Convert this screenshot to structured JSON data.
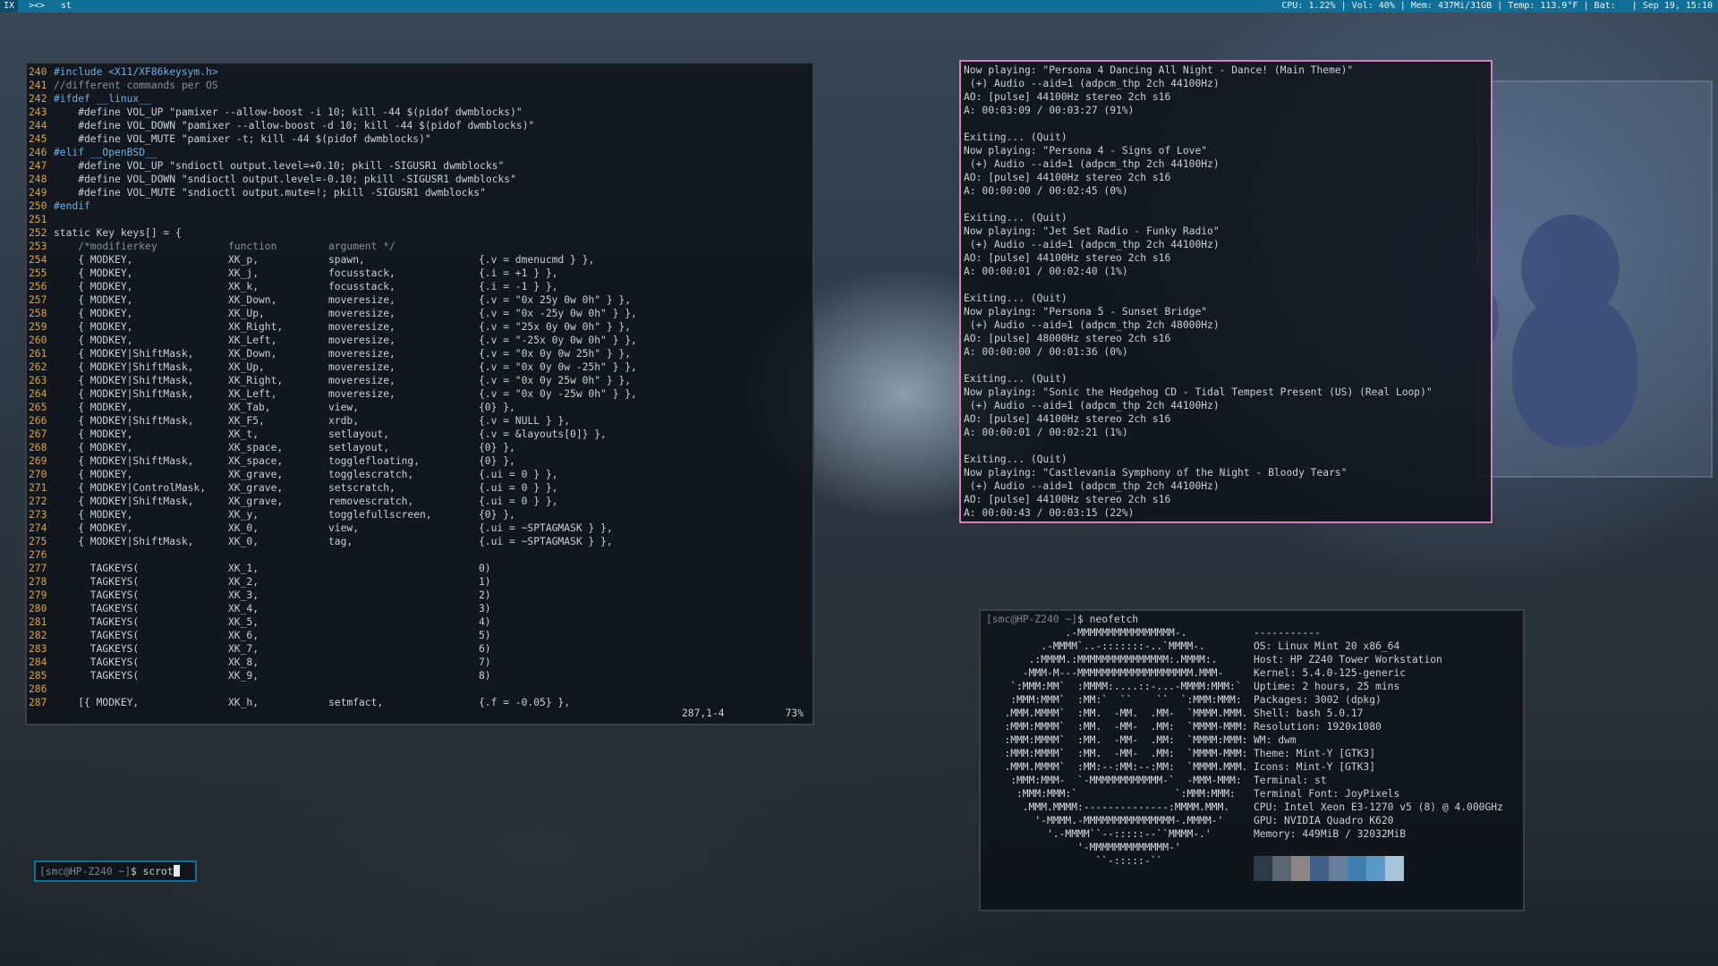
{
  "topbar": {
    "tags": [
      "IX",
      "><>",
      "st"
    ],
    "status": "CPU: 1.22% | Vol: 40% | Mem: 437Mi/31GB | Temp: 113.9°F | Bat:   | Sep 19, 15:10"
  },
  "vim": {
    "lines": [
      {
        "n": "240",
        "t": "#include <X11/XF86keysym.h>"
      },
      {
        "n": "241",
        "t": "//different commands per OS"
      },
      {
        "n": "242",
        "t": "#ifdef __linux__"
      },
      {
        "n": "243",
        "t": "    #define VOL_UP \"pamixer --allow-boost -i 10; kill -44 $(pidof dwmblocks)\""
      },
      {
        "n": "244",
        "t": "    #define VOL_DOWN \"pamixer --allow-boost -d 10; kill -44 $(pidof dwmblocks)\""
      },
      {
        "n": "245",
        "t": "    #define VOL_MUTE \"pamixer -t; kill -44 $(pidof dwmblocks)\""
      },
      {
        "n": "246",
        "t": "#elif __OpenBSD__"
      },
      {
        "n": "247",
        "t": "    #define VOL_UP \"sndioctl output.level=+0.10; pkill -SIGUSR1 dwmblocks\""
      },
      {
        "n": "248",
        "t": "    #define VOL_DOWN \"sndioctl output.level=-0.10; pkill -SIGUSR1 dwmblocks\""
      },
      {
        "n": "249",
        "t": "    #define VOL_MUTE \"sndioctl output.mute=!; pkill -SIGUSR1 dwmblocks\""
      },
      {
        "n": "250",
        "t": "#endif"
      },
      {
        "n": "251",
        "t": ""
      },
      {
        "n": "252",
        "t": "static Key keys[] = {"
      },
      {
        "n": "253",
        "c": [
          "    /*modifierkey",
          "function",
          "argument */",
          ""
        ]
      },
      {
        "n": "254",
        "c": [
          "    { MODKEY,",
          "XK_p,",
          "spawn,",
          "{.v = dmenucmd } },"
        ]
      },
      {
        "n": "255",
        "c": [
          "    { MODKEY,",
          "XK_j,",
          "focusstack,",
          "{.i = +1 } },"
        ]
      },
      {
        "n": "256",
        "c": [
          "    { MODKEY,",
          "XK_k,",
          "focusstack,",
          "{.i = -1 } },"
        ]
      },
      {
        "n": "257",
        "c": [
          "    { MODKEY,",
          "XK_Down,",
          "moveresize,",
          "{.v = \"0x 25y 0w 0h\" } },"
        ]
      },
      {
        "n": "258",
        "c": [
          "    { MODKEY,",
          "XK_Up,",
          "moveresize,",
          "{.v = \"0x -25y 0w 0h\" } },"
        ]
      },
      {
        "n": "259",
        "c": [
          "    { MODKEY,",
          "XK_Right,",
          "moveresize,",
          "{.v = \"25x 0y 0w 0h\" } },"
        ]
      },
      {
        "n": "260",
        "c": [
          "    { MODKEY,",
          "XK_Left,",
          "moveresize,",
          "{.v = \"-25x 0y 0w 0h\" } },"
        ]
      },
      {
        "n": "261",
        "c": [
          "    { MODKEY|ShiftMask,",
          "XK_Down,",
          "moveresize,",
          "{.v = \"0x 0y 0w 25h\" } },"
        ]
      },
      {
        "n": "262",
        "c": [
          "    { MODKEY|ShiftMask,",
          "XK_Up,",
          "moveresize,",
          "{.v = \"0x 0y 0w -25h\" } },"
        ]
      },
      {
        "n": "263",
        "c": [
          "    { MODKEY|ShiftMask,",
          "XK_Right,",
          "moveresize,",
          "{.v = \"0x 0y 25w 0h\" } },"
        ]
      },
      {
        "n": "264",
        "c": [
          "    { MODKEY|ShiftMask,",
          "XK_Left,",
          "moveresize,",
          "{.v = \"0x 0y -25w 0h\" } },"
        ]
      },
      {
        "n": "265",
        "c": [
          "    { MODKEY,",
          "XK_Tab,",
          "view,",
          "{0} },"
        ]
      },
      {
        "n": "266",
        "c": [
          "    { MODKEY|ShiftMask,",
          "XK_F5,",
          "xrdb,",
          "{.v = NULL } },"
        ]
      },
      {
        "n": "267",
        "c": [
          "    { MODKEY,",
          "XK_t,",
          "setlayout,",
          "{.v = &layouts[0]} },"
        ]
      },
      {
        "n": "268",
        "c": [
          "    { MODKEY,",
          "XK_space,",
          "setlayout,",
          "{0} },"
        ]
      },
      {
        "n": "269",
        "c": [
          "    { MODKEY|ShiftMask,",
          "XK_space,",
          "togglefloating,",
          "{0} },"
        ]
      },
      {
        "n": "270",
        "c": [
          "    { MODKEY,",
          "XK_grave,",
          "togglescratch,",
          "{.ui = 0 } },"
        ]
      },
      {
        "n": "271",
        "c": [
          "    { MODKEY|ControlMask,",
          "XK_grave,",
          "setscratch,",
          "{.ui = 0 } },"
        ]
      },
      {
        "n": "272",
        "c": [
          "    { MODKEY|ShiftMask,",
          "XK_grave,",
          "removescratch,",
          "{.ui = 0 } },"
        ]
      },
      {
        "n": "273",
        "c": [
          "    { MODKEY,",
          "XK_y,",
          "togglefullscreen,",
          "{0} },"
        ]
      },
      {
        "n": "274",
        "c": [
          "    { MODKEY,",
          "XK_0,",
          "view,",
          "{.ui = ~SPTAGMASK } },"
        ]
      },
      {
        "n": "275",
        "c": [
          "    { MODKEY|ShiftMask,",
          "XK_0,",
          "tag,",
          "{.ui = ~SPTAGMASK } },"
        ]
      },
      {
        "n": "276",
        "t": ""
      },
      {
        "n": "277",
        "c": [
          "      TAGKEYS(",
          "XK_1,",
          "",
          "0)"
        ]
      },
      {
        "n": "278",
        "c": [
          "      TAGKEYS(",
          "XK_2,",
          "",
          "1)"
        ]
      },
      {
        "n": "279",
        "c": [
          "      TAGKEYS(",
          "XK_3,",
          "",
          "2)"
        ]
      },
      {
        "n": "280",
        "c": [
          "      TAGKEYS(",
          "XK_4,",
          "",
          "3)"
        ]
      },
      {
        "n": "281",
        "c": [
          "      TAGKEYS(",
          "XK_5,",
          "",
          "4)"
        ]
      },
      {
        "n": "282",
        "c": [
          "      TAGKEYS(",
          "XK_6,",
          "",
          "5)"
        ]
      },
      {
        "n": "283",
        "c": [
          "      TAGKEYS(",
          "XK_7,",
          "",
          "6)"
        ]
      },
      {
        "n": "284",
        "c": [
          "      TAGKEYS(",
          "XK_8,",
          "",
          "7)"
        ]
      },
      {
        "n": "285",
        "c": [
          "      TAGKEYS(",
          "XK_9,",
          "",
          "8)"
        ]
      },
      {
        "n": "286",
        "t": ""
      },
      {
        "n": "287",
        "c": [
          "    [{ MODKEY,",
          "XK_h,",
          "setmfact,",
          "{.f = -0.05} },"
        ]
      }
    ],
    "position": "287,1-4",
    "percent": "73%"
  },
  "mpv": {
    "lines": [
      "Now playing: \"Persona 4 Dancing All Night - Dance! (Main Theme)\"",
      " (+) Audio --aid=1 (adpcm_thp 2ch 44100Hz)",
      "AO: [pulse] 44100Hz stereo 2ch s16",
      "A: 00:03:09 / 00:03:27 (91%)",
      "",
      "Exiting... (Quit)",
      "Now playing: \"Persona 4 - Signs of Love\"",
      " (+) Audio --aid=1 (adpcm_thp 2ch 44100Hz)",
      "AO: [pulse] 44100Hz stereo 2ch s16",
      "A: 00:00:00 / 00:02:45 (0%)",
      "",
      "Exiting... (Quit)",
      "Now playing: \"Jet Set Radio - Funky Radio\"",
      " (+) Audio --aid=1 (adpcm_thp 2ch 44100Hz)",
      "AO: [pulse] 44100Hz stereo 2ch s16",
      "A: 00:00:01 / 00:02:40 (1%)",
      "",
      "Exiting... (Quit)",
      "Now playing: \"Persona 5 - Sunset Bridge\"",
      " (+) Audio --aid=1 (adpcm_thp 2ch 48000Hz)",
      "AO: [pulse] 48000Hz stereo 2ch s16",
      "A: 00:00:00 / 00:01:36 (0%)",
      "",
      "Exiting... (Quit)",
      "Now playing: \"Sonic the Hedgehog CD - Tidal Tempest Present (US) (Real Loop)\"",
      " (+) Audio --aid=1 (adpcm_thp 2ch 44100Hz)",
      "AO: [pulse] 44100Hz stereo 2ch s16",
      "A: 00:00:01 / 00:02:21 (1%)",
      "",
      "Exiting... (Quit)",
      "Now playing: \"Castlevania Symphony of the Night - Bloody Tears\"",
      " (+) Audio --aid=1 (adpcm_thp 2ch 44100Hz)",
      "AO: [pulse] 44100Hz stereo 2ch s16",
      "A: 00:00:43 / 00:03:15 (22%)"
    ]
  },
  "neofetch": {
    "prompt_user": "[smc@HP-Z240 ~]",
    "prompt_cmd": "$ neofetch",
    "ascii": [
      "             .-MMMMMMMMMMMMMMMM-.",
      "         .-MMMM`..-:::::::-..`MMMM-.",
      "       .:MMMM.:MMMMMMMMMMMMMMM:.MMMM:.",
      "      -MMM-M---MMMMMMMMMMMMMMMMMMM.MMM-",
      "    `:MMM:MM`  :MMMM:....::-...-MMMM:MMM:`",
      "    :MMM:MMM`  :MM:`  ``    ``  `:MMM:MMM:",
      "   .MMM.MMMM`  :MM.  -MM.  .MM-  `MMMM.MMM.",
      "   :MMM:MMMM`  :MM.  -MM-  .MM:  `MMMM-MMM:",
      "   :MMM:MMMM`  :MM.  -MM-  .MM:  `MMMM:MMM:",
      "   :MMM:MMMM`  :MM.  -MM-  .MM:  `MMMM-MMM:",
      "   .MMM.MMMM`  :MM:--:MM:--:MM:  `MMMM.MMM.",
      "    :MMM:MMM-  `-MMMMMMMMMMMM-`  -MMM-MMM:",
      "     :MMM:MMM:`                `:MMM:MMM:",
      "      .MMM.MMMM:--------------:MMMM.MMM.",
      "        '-MMMM.-MMMMMMMMMMMMMMM-.MMMM-'",
      "          '.-MMMM``--:::::--``MMMM-.'",
      "               '-MMMMMMMMMMMMM-'",
      "                  ``-:::::-``"
    ],
    "info": [
      {
        "k": "",
        "v": "-----------"
      },
      {
        "k": "OS",
        "v": "Linux Mint 20 x86_64"
      },
      {
        "k": "Host",
        "v": "HP Z240 Tower Workstation"
      },
      {
        "k": "Kernel",
        "v": "5.4.0-125-generic"
      },
      {
        "k": "Uptime",
        "v": "2 hours, 25 mins"
      },
      {
        "k": "Packages",
        "v": "3002 (dpkg)"
      },
      {
        "k": "Shell",
        "v": "bash 5.0.17"
      },
      {
        "k": "Resolution",
        "v": "1920x1080"
      },
      {
        "k": "WM",
        "v": "dwm"
      },
      {
        "k": "Theme",
        "v": "Mint-Y [GTK3]"
      },
      {
        "k": "Icons",
        "v": "Mint-Y [GTK3]"
      },
      {
        "k": "Terminal",
        "v": "st"
      },
      {
        "k": "Terminal Font",
        "v": "JoyPixels"
      },
      {
        "k": "CPU",
        "v": "Intel Xeon E3-1270 v5 (8) @ 4.000GHz"
      },
      {
        "k": "GPU",
        "v": "NVIDIA Quadro K620"
      },
      {
        "k": "Memory",
        "v": "449MiB / 32032MiB"
      }
    ],
    "colors": [
      "#2d3a4a",
      "#5c6470",
      "#8e8686",
      "#3f5f8a",
      "#6a7f9e",
      "#3e7fb0",
      "#5b9ac8",
      "#a7c4dc"
    ]
  },
  "scratch": {
    "prompt_user": "[smc@HP-Z240 ~]",
    "prompt_cmd": "$ scrot"
  }
}
